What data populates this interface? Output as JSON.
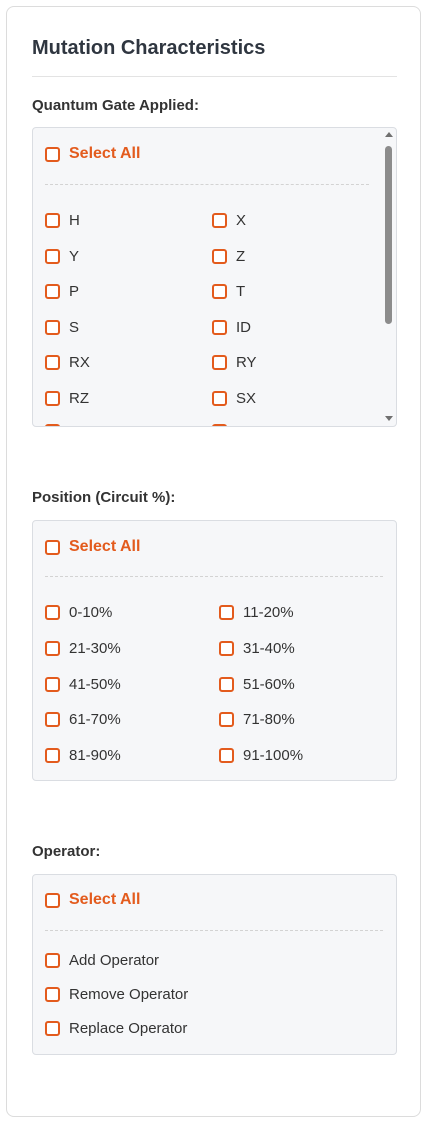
{
  "panel": {
    "title": "Mutation Characteristics"
  },
  "colors": {
    "accent": "#e35b1d",
    "box_bg": "#f6f7f9",
    "border": "#dadde2"
  },
  "gates": {
    "label": "Quantum Gate Applied:",
    "select_all": "Select All",
    "items": [
      "H",
      "X",
      "Y",
      "Z",
      "P",
      "T",
      "S",
      "ID",
      "RX",
      "RY",
      "RZ",
      "SX"
    ]
  },
  "position": {
    "label": "Position (Circuit %):",
    "select_all": "Select All",
    "items": [
      "0-10%",
      "11-20%",
      "21-30%",
      "31-40%",
      "41-50%",
      "51-60%",
      "61-70%",
      "71-80%",
      "81-90%",
      "91-100%"
    ]
  },
  "operator": {
    "label": "Operator:",
    "select_all": "Select All",
    "items": [
      "Add Operator",
      "Remove Operator",
      "Replace Operator"
    ]
  }
}
